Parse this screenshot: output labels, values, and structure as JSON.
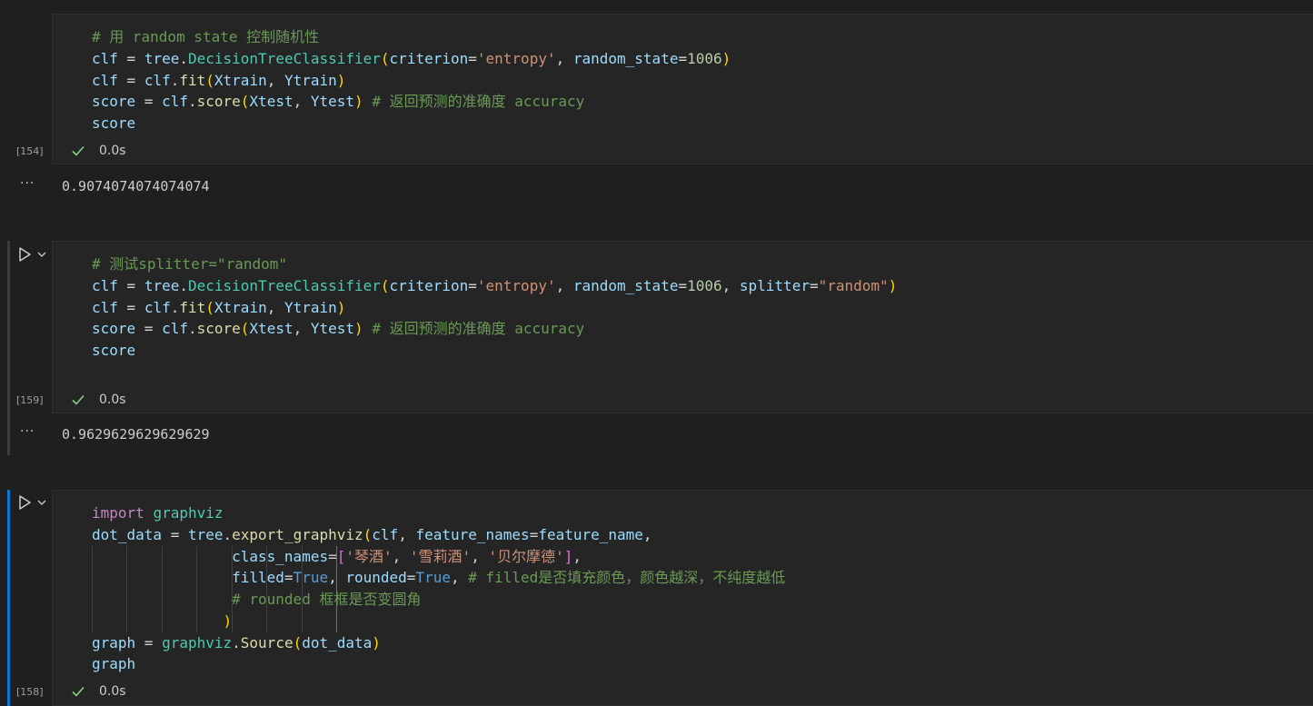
{
  "cell1": {
    "lines": [
      [
        [
          "cmt",
          "# 用 random state 控制随机性"
        ]
      ],
      [
        [
          "var",
          "clf"
        ],
        [
          "plain",
          " = "
        ],
        [
          "var",
          "tree"
        ],
        [
          "plain",
          "."
        ],
        [
          "cls",
          "DecisionTreeClassifier"
        ],
        [
          "p1",
          "("
        ],
        [
          "var",
          "criterion"
        ],
        [
          "plain",
          "="
        ],
        [
          "str",
          "'entropy'"
        ],
        [
          "plain",
          ", "
        ],
        [
          "var",
          "random_state"
        ],
        [
          "plain",
          "="
        ],
        [
          "num",
          "1006"
        ],
        [
          "p1",
          ")"
        ]
      ],
      [
        [
          "var",
          "clf"
        ],
        [
          "plain",
          " = "
        ],
        [
          "var",
          "clf"
        ],
        [
          "plain",
          "."
        ],
        [
          "fn",
          "fit"
        ],
        [
          "p1",
          "("
        ],
        [
          "var",
          "Xtrain"
        ],
        [
          "plain",
          ", "
        ],
        [
          "var",
          "Ytrain"
        ],
        [
          "p1",
          ")"
        ]
      ],
      [
        [
          "var",
          "score"
        ],
        [
          "plain",
          " = "
        ],
        [
          "var",
          "clf"
        ],
        [
          "plain",
          "."
        ],
        [
          "fn",
          "score"
        ],
        [
          "p1",
          "("
        ],
        [
          "var",
          "Xtest"
        ],
        [
          "plain",
          ", "
        ],
        [
          "var",
          "Ytest"
        ],
        [
          "p1",
          ")"
        ],
        [
          "plain",
          " "
        ],
        [
          "cmt",
          "# 返回预测的准确度 accuracy"
        ]
      ],
      [
        [
          "var",
          "score"
        ]
      ]
    ],
    "exec_count": "[154]",
    "time": "0.0s",
    "output": "0.9074074074074074"
  },
  "cell2": {
    "lines": [
      [
        [
          "cmt",
          "# 测试splitter=\"random\""
        ]
      ],
      [
        [
          "var",
          "clf"
        ],
        [
          "plain",
          " = "
        ],
        [
          "var",
          "tree"
        ],
        [
          "plain",
          "."
        ],
        [
          "cls",
          "DecisionTreeClassifier"
        ],
        [
          "p1",
          "("
        ],
        [
          "var",
          "criterion"
        ],
        [
          "plain",
          "="
        ],
        [
          "str",
          "'entropy'"
        ],
        [
          "plain",
          ", "
        ],
        [
          "var",
          "random_state"
        ],
        [
          "plain",
          "="
        ],
        [
          "num",
          "1006"
        ],
        [
          "plain",
          ", "
        ],
        [
          "var",
          "splitter"
        ],
        [
          "plain",
          "="
        ],
        [
          "str",
          "\"random\""
        ],
        [
          "p1",
          ")"
        ]
      ],
      [
        [
          "var",
          "clf"
        ],
        [
          "plain",
          " = "
        ],
        [
          "var",
          "clf"
        ],
        [
          "plain",
          "."
        ],
        [
          "fn",
          "fit"
        ],
        [
          "p1",
          "("
        ],
        [
          "var",
          "Xtrain"
        ],
        [
          "plain",
          ", "
        ],
        [
          "var",
          "Ytrain"
        ],
        [
          "p1",
          ")"
        ]
      ],
      [
        [
          "var",
          "score"
        ],
        [
          "plain",
          " = "
        ],
        [
          "var",
          "clf"
        ],
        [
          "plain",
          "."
        ],
        [
          "fn",
          "score"
        ],
        [
          "p1",
          "("
        ],
        [
          "var",
          "Xtest"
        ],
        [
          "plain",
          ", "
        ],
        [
          "var",
          "Ytest"
        ],
        [
          "p1",
          ")"
        ],
        [
          "plain",
          " "
        ],
        [
          "cmt",
          "# 返回预测的准确度 accuracy"
        ]
      ],
      [
        [
          "var",
          "score"
        ]
      ]
    ],
    "exec_count": "[159]",
    "time": "0.0s",
    "output": "0.9629629629629629"
  },
  "cell3": {
    "lines": [
      [
        [
          "kw",
          "import"
        ],
        [
          "plain",
          " "
        ],
        [
          "cls",
          "graphviz"
        ]
      ],
      [
        [
          "var",
          "dot_data"
        ],
        [
          "plain",
          " = "
        ],
        [
          "var",
          "tree"
        ],
        [
          "plain",
          "."
        ],
        [
          "fn",
          "export_graphviz"
        ],
        [
          "p1",
          "("
        ],
        [
          "var",
          "clf"
        ],
        [
          "plain",
          ", "
        ],
        [
          "var",
          "feature_names"
        ],
        [
          "plain",
          "="
        ],
        [
          "var",
          "feature_name"
        ],
        [
          "plain",
          ","
        ]
      ],
      [
        [
          "plain",
          "                "
        ],
        [
          "var",
          "class_names"
        ],
        [
          "plain",
          "="
        ],
        [
          "p2",
          "["
        ],
        [
          "str",
          "'琴酒'"
        ],
        [
          "plain",
          ", "
        ],
        [
          "str",
          "'雪莉酒'"
        ],
        [
          "plain",
          ", "
        ],
        [
          "str",
          "'贝尔摩德'"
        ],
        [
          "p2",
          "]"
        ],
        [
          "plain",
          ","
        ]
      ],
      [
        [
          "plain",
          "                "
        ],
        [
          "var",
          "filled"
        ],
        [
          "plain",
          "="
        ],
        [
          "cst",
          "True"
        ],
        [
          "plain",
          ", "
        ],
        [
          "var",
          "rounded"
        ],
        [
          "plain",
          "="
        ],
        [
          "cst",
          "True"
        ],
        [
          "plain",
          ", "
        ],
        [
          "cmt",
          "# filled是否填充颜色，颜色越深，不纯度越低"
        ]
      ],
      [
        [
          "plain",
          "                "
        ],
        [
          "cmt",
          "# rounded 框框是否变圆角"
        ]
      ],
      [
        [
          "plain",
          "               "
        ],
        [
          "p1",
          ")"
        ]
      ],
      [
        [
          "var",
          "graph"
        ],
        [
          "plain",
          " = "
        ],
        [
          "cls",
          "graphviz"
        ],
        [
          "plain",
          "."
        ],
        [
          "fn",
          "Source"
        ],
        [
          "p1",
          "("
        ],
        [
          "var",
          "dot_data"
        ],
        [
          "p1",
          ")"
        ]
      ],
      [
        [
          "var",
          "graph"
        ]
      ]
    ],
    "exec_count": "[158]",
    "time": "0.0s"
  },
  "colors": {
    "accent": "#0078d4",
    "check": "#89d185",
    "background": "#1f1f1f",
    "cell": "#252526"
  }
}
